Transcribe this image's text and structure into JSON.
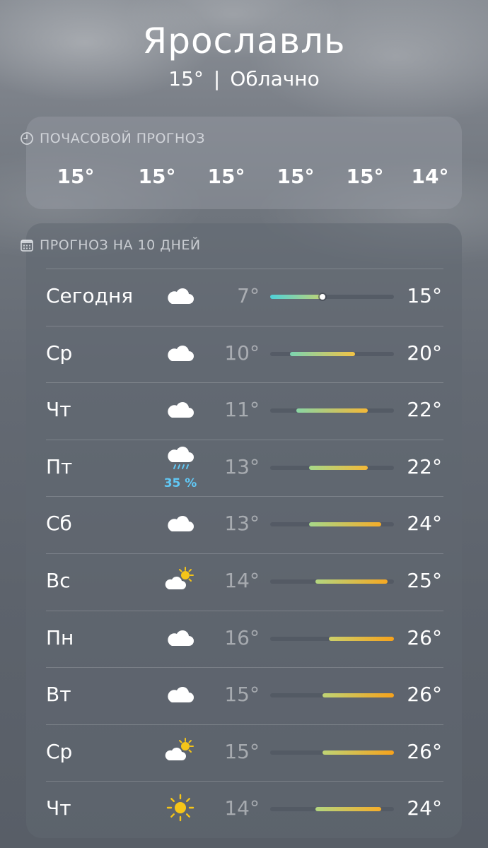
{
  "location": {
    "city": "Ярославль",
    "temp": "15°",
    "separator": "|",
    "condition": "Облачно"
  },
  "hourly": {
    "title": "ПОЧАСОВОЙ ПРОГНОЗ",
    "temps": [
      "15°",
      "15°",
      "15°",
      "15°",
      "15°",
      "14°"
    ]
  },
  "daily": {
    "title": "ПРОГНОЗ НА 10 ДНЕЙ",
    "range_min": 7,
    "range_max": 26,
    "days": [
      {
        "day": "Сегодня",
        "icon": "cloud-icon",
        "low": "7°",
        "high": "15°",
        "low_value": 7,
        "high_value": 15,
        "current": 15,
        "precip": ""
      },
      {
        "day": "Ср",
        "icon": "cloud-icon",
        "low": "10°",
        "high": "20°",
        "low_value": 10,
        "high_value": 20,
        "precip": ""
      },
      {
        "day": "Чт",
        "icon": "cloud-icon",
        "low": "11°",
        "high": "22°",
        "low_value": 11,
        "high_value": 22,
        "precip": ""
      },
      {
        "day": "Пт",
        "icon": "rain-cloud-icon",
        "low": "13°",
        "high": "22°",
        "low_value": 13,
        "high_value": 22,
        "precip": "35 %"
      },
      {
        "day": "Сб",
        "icon": "cloud-icon",
        "low": "13°",
        "high": "24°",
        "low_value": 13,
        "high_value": 24,
        "precip": ""
      },
      {
        "day": "Вс",
        "icon": "partly-cloudy-icon",
        "low": "14°",
        "high": "25°",
        "low_value": 14,
        "high_value": 25,
        "precip": ""
      },
      {
        "day": "Пн",
        "icon": "cloud-icon",
        "low": "16°",
        "high": "26°",
        "low_value": 16,
        "high_value": 26,
        "precip": ""
      },
      {
        "day": "Вт",
        "icon": "cloud-icon",
        "low": "15°",
        "high": "26°",
        "low_value": 15,
        "high_value": 26,
        "precip": ""
      },
      {
        "day": "Ср",
        "icon": "partly-cloudy-icon",
        "low": "15°",
        "high": "26°",
        "low_value": 15,
        "high_value": 26,
        "precip": ""
      },
      {
        "day": "Чт",
        "icon": "sun-icon",
        "low": "14°",
        "high": "24°",
        "low_value": 14,
        "high_value": 24,
        "precip": ""
      }
    ]
  },
  "colors": {
    "cool": "#4fd1d9",
    "mild": "#a6d98a",
    "warm": "#f2c94c",
    "hot": "#f7a21b",
    "precip": "#61c8f5"
  }
}
